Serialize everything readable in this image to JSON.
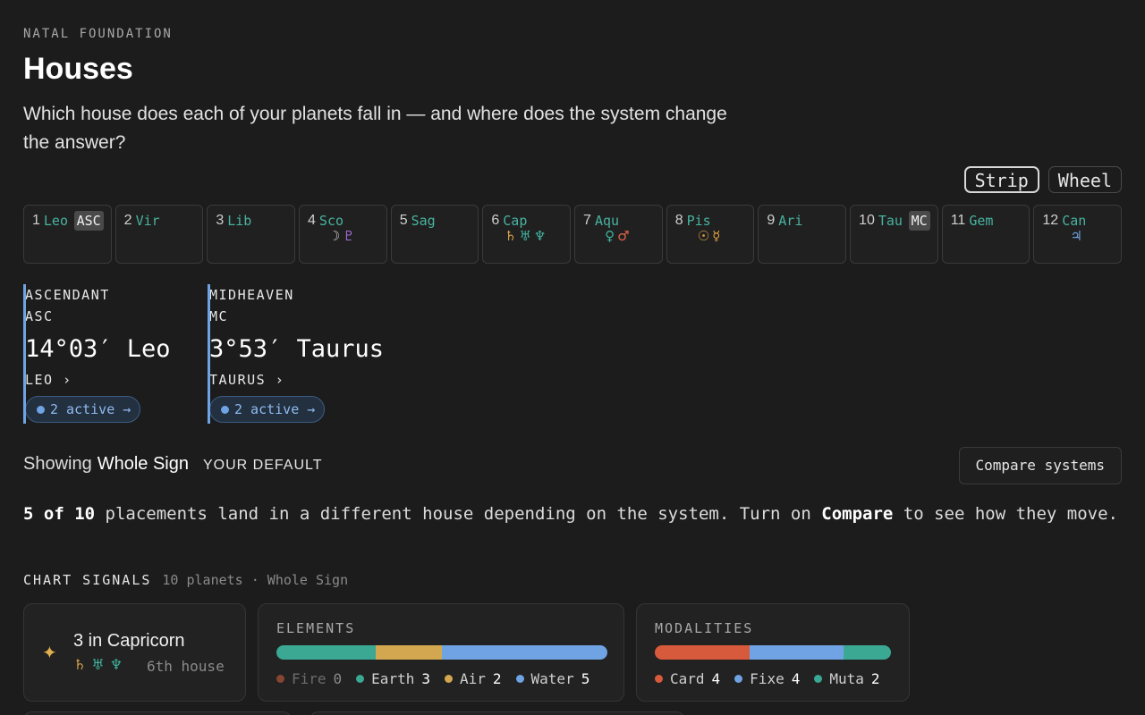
{
  "header": {
    "eyebrow": "NATAL FOUNDATION",
    "title": "Houses",
    "subtitle": "Which house does each of your planets fall in — and where does the system change the answer?"
  },
  "view_toggle": {
    "strip_label": "Strip",
    "wheel_label": "Wheel",
    "active": "Strip"
  },
  "houses": [
    {
      "num": "1",
      "sign": "Leo",
      "badge": "ASC",
      "planets": []
    },
    {
      "num": "2",
      "sign": "Vir",
      "badge": "",
      "planets": []
    },
    {
      "num": "3",
      "sign": "Lib",
      "badge": "",
      "planets": []
    },
    {
      "num": "4",
      "sign": "Sco",
      "badge": "",
      "planets": [
        {
          "glyph": "☽",
          "color": "#c8c8c8"
        },
        {
          "glyph": "♇",
          "color": "#a86fe0"
        }
      ]
    },
    {
      "num": "5",
      "sign": "Sag",
      "badge": "",
      "planets": []
    },
    {
      "num": "6",
      "sign": "Cap",
      "badge": "",
      "planets": [
        {
          "glyph": "♄",
          "color": "#d4a24a"
        },
        {
          "glyph": "♅",
          "color": "#40b29d"
        },
        {
          "glyph": "♆",
          "color": "#40b29d"
        }
      ]
    },
    {
      "num": "7",
      "sign": "Aqu",
      "badge": "",
      "planets": [
        {
          "glyph": "♀",
          "color": "#40b29d"
        },
        {
          "glyph": "♂",
          "color": "#e0644a"
        }
      ]
    },
    {
      "num": "8",
      "sign": "Pis",
      "badge": "",
      "planets": [
        {
          "glyph": "☉",
          "color": "#e0a040"
        },
        {
          "glyph": "☿",
          "color": "#e0a040"
        }
      ]
    },
    {
      "num": "9",
      "sign": "Ari",
      "badge": "",
      "planets": []
    },
    {
      "num": "10",
      "sign": "Tau",
      "badge": "MC",
      "planets": []
    },
    {
      "num": "11",
      "sign": "Gem",
      "badge": "",
      "planets": []
    },
    {
      "num": "12",
      "sign": "Can",
      "badge": "",
      "planets": [
        {
          "glyph": "♃",
          "color": "#6fa3e3"
        }
      ]
    }
  ],
  "angles": {
    "asc": {
      "label": "ASCENDANT",
      "abbr": "ASC",
      "position": "14°03′ Leo",
      "sign_link": "LEO",
      "active": "2 active →"
    },
    "mc": {
      "label": "MIDHEAVEN",
      "abbr": "MC",
      "position": "3°53′ Taurus",
      "sign_link": "TAURUS",
      "active": "2 active →"
    }
  },
  "system": {
    "showing_prefix": "Showing",
    "name": "Whole Sign",
    "default_tag": "YOUR DEFAULT",
    "compare_label": "Compare systems"
  },
  "notice": {
    "count": "5 of 10",
    "middle": " placements land in a different house depending on the system. Turn on ",
    "emph": "Compare",
    "end": " to see how they move."
  },
  "signals": {
    "label": "CHART SIGNALS",
    "meta": "10 planets · Whole Sign",
    "stellium": {
      "headline": "3 in Capricorn",
      "glyphs": [
        "♄",
        "♅",
        "♆"
      ],
      "house": "6th house"
    },
    "elements": {
      "label": "ELEMENTS",
      "items": [
        {
          "name": "Fire",
          "count": 0,
          "color": "#b0543a"
        },
        {
          "name": "Earth",
          "count": 3,
          "color": "#3aa893"
        },
        {
          "name": "Air",
          "count": 2,
          "color": "#d3a750"
        },
        {
          "name": "Water",
          "count": 5,
          "color": "#6fa3e3"
        }
      ]
    },
    "modalities": {
      "label": "MODALITIES",
      "items": [
        {
          "name": "Card",
          "count": 4,
          "color": "#d85a3c"
        },
        {
          "name": "Fixe",
          "count": 4,
          "color": "#6fa3e3"
        },
        {
          "name": "Muta",
          "count": 2,
          "color": "#3aa893"
        }
      ]
    }
  },
  "colors": {
    "accent_blue": "#6fa3e3",
    "sign_teal": "#47b3a0",
    "background": "#1c1c1c"
  }
}
